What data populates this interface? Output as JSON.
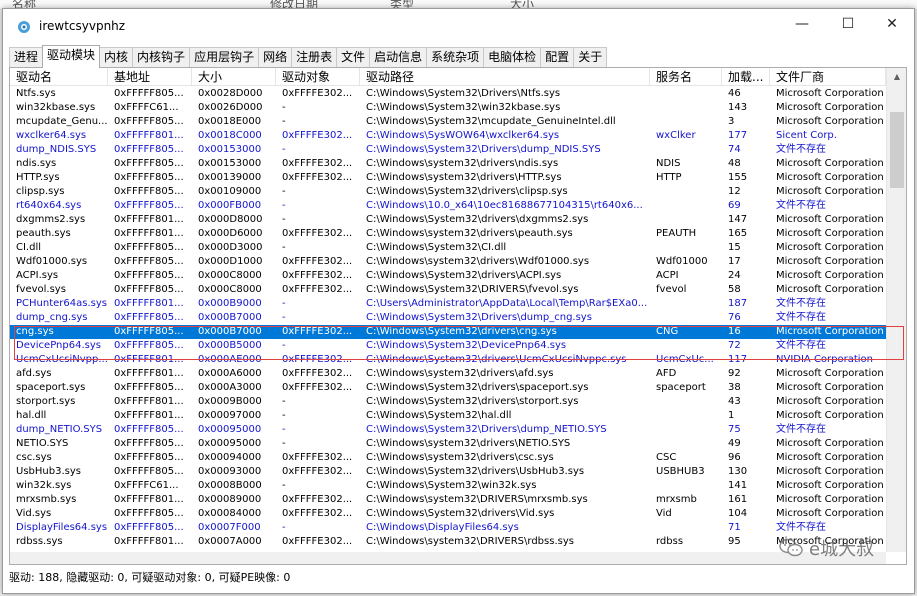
{
  "background_header": [
    "名称",
    "修改日期",
    "类型",
    "大小"
  ],
  "window": {
    "title": "irewtcsyvpnhz",
    "controls": {
      "minimize": "—",
      "maximize": "☐",
      "close": "✕"
    }
  },
  "tabs": [
    "进程",
    "驱动模块",
    "内核",
    "内核钩子",
    "应用层钩子",
    "网络",
    "注册表",
    "文件",
    "启动信息",
    "系统杂项",
    "电脑体检",
    "配置",
    "关于"
  ],
  "active_tab": "驱动模块",
  "columns": [
    "驱动名",
    "基地址",
    "大小",
    "驱动对象",
    "驱动路径",
    "服务名",
    "加载...",
    "文件厂商"
  ],
  "rows": [
    {
      "name": "Ntfs.sys",
      "base": "0xFFFFF805...",
      "size": "0x0028D000",
      "obj": "0xFFFFE302...",
      "path": "C:\\Windows\\System32\\Drivers\\Ntfs.sys",
      "svc": "",
      "order": "46",
      "vendor": "Microsoft Corporation",
      "style": "normal"
    },
    {
      "name": "win32kbase.sys",
      "base": "0xFFFFC61...",
      "size": "0x0026D000",
      "obj": "-",
      "path": "C:\\Windows\\System32\\win32kbase.sys",
      "svc": "",
      "order": "143",
      "vendor": "Microsoft Corporation",
      "style": "normal"
    },
    {
      "name": "mcupdate_Genu...",
      "base": "0xFFFFF805...",
      "size": "0x0018E000",
      "obj": "-",
      "path": "C:\\Windows\\System32\\mcupdate_GenuineIntel.dll",
      "svc": "",
      "order": "3",
      "vendor": "Microsoft Corporation",
      "style": "normal"
    },
    {
      "name": "wxclker64.sys",
      "base": "0xFFFFF801...",
      "size": "0x0018C000",
      "obj": "0xFFFFE302...",
      "path": "C:\\Windows\\SysWOW64\\wxclker64.sys",
      "svc": "wxClker",
      "order": "177",
      "vendor": "Sicent Corp.",
      "style": "blue"
    },
    {
      "name": "dump_NDIS.SYS",
      "base": "0xFFFFF805...",
      "size": "0x00153000",
      "obj": "-",
      "path": "C:\\Windows\\System32\\Drivers\\dump_NDIS.SYS",
      "svc": "",
      "order": "74",
      "vendor": "文件不存在",
      "style": "blue"
    },
    {
      "name": "ndis.sys",
      "base": "0xFFFFF805...",
      "size": "0x00153000",
      "obj": "0xFFFFE302...",
      "path": "C:\\Windows\\system32\\drivers\\ndis.sys",
      "svc": "NDIS",
      "order": "48",
      "vendor": "Microsoft Corporation",
      "style": "normal"
    },
    {
      "name": "HTTP.sys",
      "base": "0xFFFFF805...",
      "size": "0x00139000",
      "obj": "0xFFFFE302...",
      "path": "C:\\Windows\\system32\\drivers\\HTTP.sys",
      "svc": "HTTP",
      "order": "155",
      "vendor": "Microsoft Corporation",
      "style": "normal"
    },
    {
      "name": "clipsp.sys",
      "base": "0xFFFFF805...",
      "size": "0x00109000",
      "obj": "-",
      "path": "C:\\Windows\\System32\\drivers\\clipsp.sys",
      "svc": "",
      "order": "12",
      "vendor": "Microsoft Corporation",
      "style": "normal"
    },
    {
      "name": "rt640x64.sys",
      "base": "0xFFFFF805...",
      "size": "0x000FB000",
      "obj": "-",
      "path": "C:\\Windows\\10.0_x64\\10ec81688677104315\\rt640x6...",
      "svc": "",
      "order": "69",
      "vendor": "文件不存在",
      "style": "blue"
    },
    {
      "name": "dxgmms2.sys",
      "base": "0xFFFFF801...",
      "size": "0x000D8000",
      "obj": "-",
      "path": "C:\\Windows\\System32\\drivers\\dxgmms2.sys",
      "svc": "",
      "order": "147",
      "vendor": "Microsoft Corporation",
      "style": "normal"
    },
    {
      "name": "peauth.sys",
      "base": "0xFFFFF801...",
      "size": "0x000D6000",
      "obj": "0xFFFFE302...",
      "path": "C:\\Windows\\system32\\drivers\\peauth.sys",
      "svc": "PEAUTH",
      "order": "165",
      "vendor": "Microsoft Corporation",
      "style": "normal"
    },
    {
      "name": "CI.dll",
      "base": "0xFFFFF805...",
      "size": "0x000D3000",
      "obj": "-",
      "path": "C:\\Windows\\System32\\CI.dll",
      "svc": "",
      "order": "15",
      "vendor": "Microsoft Corporation",
      "style": "normal"
    },
    {
      "name": "Wdf01000.sys",
      "base": "0xFFFFF805...",
      "size": "0x000D1000",
      "obj": "0xFFFFE302...",
      "path": "C:\\Windows\\system32\\drivers\\Wdf01000.sys",
      "svc": "Wdf01000",
      "order": "17",
      "vendor": "Microsoft Corporation",
      "style": "normal"
    },
    {
      "name": "ACPI.sys",
      "base": "0xFFFFF805...",
      "size": "0x000C8000",
      "obj": "0xFFFFE302...",
      "path": "C:\\Windows\\System32\\drivers\\ACPI.sys",
      "svc": "ACPI",
      "order": "24",
      "vendor": "Microsoft Corporation",
      "style": "normal"
    },
    {
      "name": "fvevol.sys",
      "base": "0xFFFFF805...",
      "size": "0x000C8000",
      "obj": "0xFFFFE302...",
      "path": "C:\\Windows\\System32\\DRIVERS\\fvevol.sys",
      "svc": "fvevol",
      "order": "58",
      "vendor": "Microsoft Corporation",
      "style": "normal"
    },
    {
      "name": "PCHunter64as.sys",
      "base": "0xFFFFF801...",
      "size": "0x000B9000",
      "obj": "-",
      "path": "C:\\Users\\Administrator\\AppData\\Local\\Temp\\Rar$EXa0...",
      "svc": "",
      "order": "187",
      "vendor": "文件不存在",
      "style": "blue"
    },
    {
      "name": "dump_cng.sys",
      "base": "0xFFFFF805...",
      "size": "0x000B7000",
      "obj": "-",
      "path": "C:\\Windows\\System32\\Drivers\\dump_cng.sys",
      "svc": "",
      "order": "76",
      "vendor": "文件不存在",
      "style": "blue"
    },
    {
      "name": "cng.sys",
      "base": "0xFFFFF805...",
      "size": "0x000B7000",
      "obj": "0xFFFFE302...",
      "path": "C:\\Windows\\System32\\drivers\\cng.sys",
      "svc": "CNG",
      "order": "16",
      "vendor": "Microsoft Corporation",
      "style": "selected"
    },
    {
      "name": "DevicePnp64.sys",
      "base": "0xFFFFF805...",
      "size": "0x000B5000",
      "obj": "-",
      "path": "C:\\Windows\\System32\\DevicePnp64.sys",
      "svc": "",
      "order": "72",
      "vendor": "文件不存在",
      "style": "blue"
    },
    {
      "name": "UcmCxUcsiNvpp...",
      "base": "0xFFFFF801...",
      "size": "0x000AE000",
      "obj": "0xFFFFE302...",
      "path": "C:\\Windows\\System32\\drivers\\UcmCxUcsiNvppc.sys",
      "svc": "UcmCxUc...",
      "order": "117",
      "vendor": "NVIDIA Corporation",
      "style": "blue"
    },
    {
      "name": "afd.sys",
      "base": "0xFFFFF801...",
      "size": "0x000A6000",
      "obj": "0xFFFFE302...",
      "path": "C:\\Windows\\system32\\drivers\\afd.sys",
      "svc": "AFD",
      "order": "92",
      "vendor": "Microsoft Corporation",
      "style": "normal"
    },
    {
      "name": "spaceport.sys",
      "base": "0xFFFFF805...",
      "size": "0x000A3000",
      "obj": "0xFFFFE302...",
      "path": "C:\\Windows\\System32\\drivers\\spaceport.sys",
      "svc": "spaceport",
      "order": "38",
      "vendor": "Microsoft Corporation",
      "style": "normal"
    },
    {
      "name": "storport.sys",
      "base": "0xFFFFF801...",
      "size": "0x0009B000",
      "obj": "-",
      "path": "C:\\Windows\\System32\\drivers\\storport.sys",
      "svc": "",
      "order": "43",
      "vendor": "Microsoft Corporation",
      "style": "normal"
    },
    {
      "name": "hal.dll",
      "base": "0xFFFFF801...",
      "size": "0x00097000",
      "obj": "-",
      "path": "C:\\Windows\\System32\\hal.dll",
      "svc": "",
      "order": "1",
      "vendor": "Microsoft Corporation",
      "style": "normal"
    },
    {
      "name": "dump_NETIO.SYS",
      "base": "0xFFFFF805...",
      "size": "0x00095000",
      "obj": "-",
      "path": "C:\\Windows\\System32\\Drivers\\dump_NETIO.SYS",
      "svc": "",
      "order": "75",
      "vendor": "文件不存在",
      "style": "blue"
    },
    {
      "name": "NETIO.SYS",
      "base": "0xFFFFF805...",
      "size": "0x00095000",
      "obj": "-",
      "path": "C:\\Windows\\system32\\drivers\\NETIO.SYS",
      "svc": "",
      "order": "49",
      "vendor": "Microsoft Corporation",
      "style": "normal"
    },
    {
      "name": "csc.sys",
      "base": "0xFFFFF805...",
      "size": "0x00094000",
      "obj": "0xFFFFE302...",
      "path": "C:\\Windows\\system32\\drivers\\csc.sys",
      "svc": "CSC",
      "order": "96",
      "vendor": "Microsoft Corporation",
      "style": "normal"
    },
    {
      "name": "UsbHub3.sys",
      "base": "0xFFFFF805...",
      "size": "0x00093000",
      "obj": "0xFFFFE302...",
      "path": "C:\\Windows\\System32\\drivers\\UsbHub3.sys",
      "svc": "USBHUB3",
      "order": "130",
      "vendor": "Microsoft Corporation",
      "style": "normal"
    },
    {
      "name": "win32k.sys",
      "base": "0xFFFFC61...",
      "size": "0x0008B000",
      "obj": "-",
      "path": "C:\\Windows\\System32\\win32k.sys",
      "svc": "",
      "order": "141",
      "vendor": "Microsoft Corporation",
      "style": "normal"
    },
    {
      "name": "mrxsmb.sys",
      "base": "0xFFFFF801...",
      "size": "0x00089000",
      "obj": "0xFFFFE302...",
      "path": "C:\\Windows\\system32\\DRIVERS\\mrxsmb.sys",
      "svc": "mrxsmb",
      "order": "161",
      "vendor": "Microsoft Corporation",
      "style": "normal"
    },
    {
      "name": "Vid.sys",
      "base": "0xFFFFF805...",
      "size": "0x00084000",
      "obj": "0xFFFFE302...",
      "path": "C:\\Windows\\System32\\drivers\\Vid.sys",
      "svc": "Vid",
      "order": "104",
      "vendor": "Microsoft Corporation",
      "style": "normal"
    },
    {
      "name": "DisplayFiles64.sys",
      "base": "0xFFFFF805...",
      "size": "0x0007F000",
      "obj": "-",
      "path": "C:\\Windows\\DisplayFiles64.sys",
      "svc": "",
      "order": "71",
      "vendor": "文件不存在",
      "style": "blue"
    },
    {
      "name": "rdbss.sys",
      "base": "0xFFFFF801...",
      "size": "0x0007A000",
      "obj": "0xFFFFE302...",
      "path": "C:\\Windows\\system32\\DRIVERS\\rdbss.sys",
      "svc": "rdbss",
      "order": "95",
      "vendor": "Microsoft Corporation",
      "style": "normal"
    }
  ],
  "status_bar": "驱动: 188, 隐藏驱动: 0, 可疑驱动对象: 0, 可疑PE映像: 0",
  "watermark": "e城大叔",
  "colors": {
    "hidden_text": "#1414cc",
    "selection": "#0078d7",
    "highlight_box": "#e04040"
  }
}
